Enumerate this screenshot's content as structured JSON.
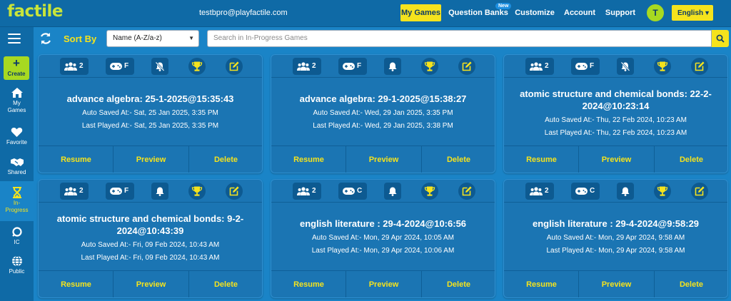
{
  "app": {
    "logo": "factile"
  },
  "header": {
    "email": "testbpro@playfactile.com",
    "nav": [
      "My Games",
      "Question Banks",
      "Customize",
      "Account",
      "Support"
    ],
    "new_badge": "New",
    "avatar_initial": "T",
    "language": "English"
  },
  "sidebar": {
    "create": "Create",
    "items": [
      "My Games",
      "Favorite",
      "Shared",
      "In-Progress",
      "IC",
      "Public"
    ]
  },
  "toolbar": {
    "sort_label": "Sort By",
    "sort_value": "Name (A-Z/a-z)",
    "search_placeholder": "Search in In-Progress Games"
  },
  "cards": [
    {
      "players": "2",
      "mode": "F",
      "bell": "muted",
      "title": "advance algebra: 25-1-2025@15:35:43",
      "auto_saved": "Auto Saved At:- Sat, 25 Jan 2025, 3:35 PM",
      "last_played": "Last Played At:- Sat, 25 Jan 2025, 3:35 PM",
      "resume": "Resume",
      "preview": "Preview",
      "delete": "Delete"
    },
    {
      "players": "2",
      "mode": "F",
      "bell": "on",
      "title": "advance algebra: 29-1-2025@15:38:27",
      "auto_saved": "Auto Saved At:- Wed, 29 Jan 2025, 3:35 PM",
      "last_played": "Last Played At:- Wed, 29 Jan 2025, 3:38 PM",
      "resume": "Resume",
      "preview": "Preview",
      "delete": "Delete"
    },
    {
      "players": "2",
      "mode": "F",
      "bell": "muted",
      "title": "atomic structure and chemical bonds: 22-2-2024@10:23:14",
      "auto_saved": "Auto Saved At:- Thu, 22 Feb 2024, 10:23 AM",
      "last_played": "Last Played At:- Thu, 22 Feb 2024, 10:23 AM",
      "resume": "Resume",
      "preview": "Preview",
      "delete": "Delete"
    },
    {
      "players": "2",
      "mode": "F",
      "bell": "on",
      "title": "atomic structure and chemical bonds: 9-2-2024@10:43:39",
      "auto_saved": "Auto Saved At:- Fri, 09 Feb 2024, 10:43 AM",
      "last_played": "Last Played At:- Fri, 09 Feb 2024, 10:43 AM",
      "resume": "Resume",
      "preview": "Preview",
      "delete": "Delete"
    },
    {
      "players": "2",
      "mode": "C",
      "bell": "on",
      "title": "english literature : 29-4-2024@10:6:56",
      "auto_saved": "Auto Saved At:- Mon, 29 Apr 2024, 10:05 AM",
      "last_played": "Last Played At:- Mon, 29 Apr 2024, 10:06 AM",
      "resume": "Resume",
      "preview": "Preview",
      "delete": "Delete"
    },
    {
      "players": "2",
      "mode": "C",
      "bell": "on",
      "title": "english literature : 29-4-2024@9:58:29",
      "auto_saved": "Auto Saved At:- Mon, 29 Apr 2024, 9:58 AM",
      "last_played": "Last Played At:- Mon, 29 Apr 2024, 9:58 AM",
      "resume": "Resume",
      "preview": "Preview",
      "delete": "Delete"
    }
  ],
  "colors": {
    "background": "#1a84c7",
    "nav_bg": "#0f6aa6",
    "card_bg": "#1b75b3",
    "accent_yellow": "#f5e31d",
    "accent_green": "#a7d921"
  }
}
